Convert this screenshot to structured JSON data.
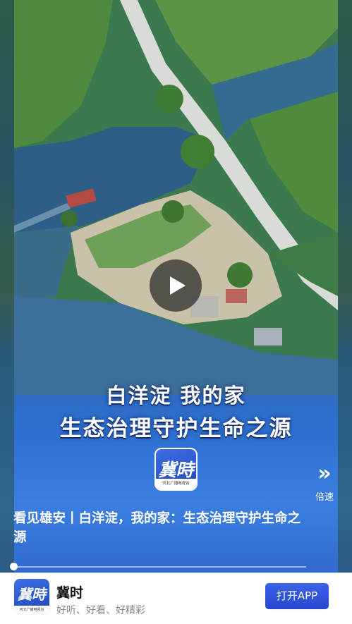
{
  "video": {
    "title_line1": "白洋淀 我的家",
    "title_line2": "生态治理守护生命之源",
    "caption": "看见雄安丨白洋淀，我的家：生态治理守护生命之源",
    "logo_glyph": "冀時",
    "logo_strip_text": "河北广播电视台",
    "speed_icon": "»",
    "speed_label": "倍速",
    "progress": 0.0
  },
  "banner": {
    "logo_glyph": "冀時",
    "logo_strip_text": "河北广播电视台",
    "app_name": "冀时",
    "tagline": "好听、好看、好精彩",
    "open_button": "打开APP"
  },
  "colors": {
    "accent": "#2b4fd6",
    "video_blue": "#2d6fd0"
  }
}
